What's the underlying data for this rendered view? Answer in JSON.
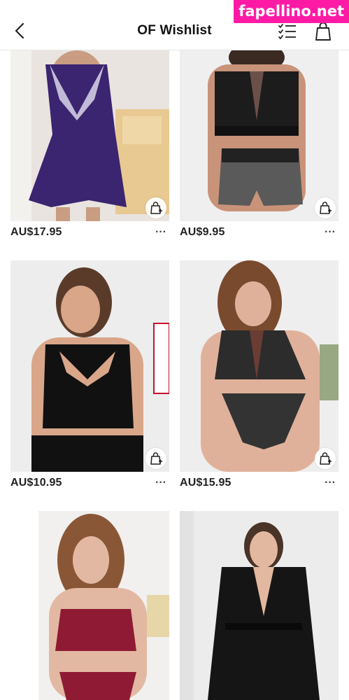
{
  "header": {
    "title": "OF Wishlist"
  },
  "watermark": "fapellino.net",
  "products": [
    {
      "price": "AU$17.95"
    },
    {
      "price": "AU$9.95"
    },
    {
      "price": "AU$10.95"
    },
    {
      "price": "AU$15.95"
    },
    {
      "price": ""
    },
    {
      "price": ""
    }
  ],
  "more_label": "···"
}
